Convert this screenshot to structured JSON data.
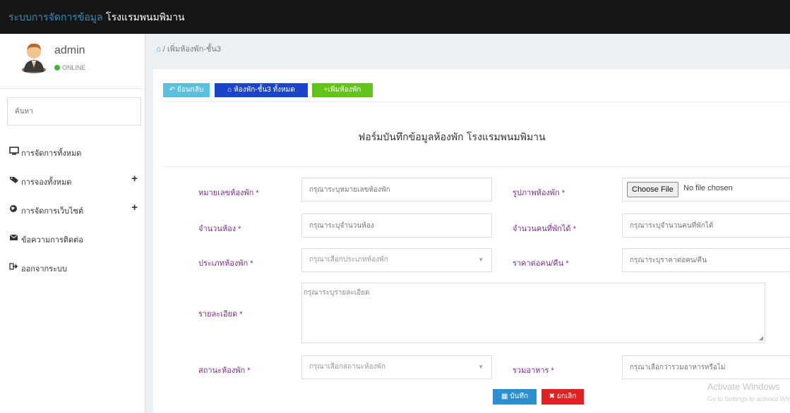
{
  "brand": {
    "part1": "ระบบการจัดการข้อมูล",
    "part2": " โรงแรมพนมพิมาน"
  },
  "user": {
    "name": "admin",
    "status": "ONLINE"
  },
  "sidebar": {
    "search_placeholder": "ค้นหา",
    "items": [
      {
        "icon": "monitor-icon",
        "label": "การจัดการทั้งหมด"
      },
      {
        "icon": "tag-icon",
        "label": "การจองทั้งหมด",
        "expand": "+"
      },
      {
        "icon": "globe-icon",
        "label": "การจัดการเว็บไซต์",
        "expand": "+"
      },
      {
        "icon": "envelope-icon",
        "label": "ข้อความการติดต่อ"
      },
      {
        "icon": "sign-out-icon",
        "label": "ออกจากระบบ"
      }
    ]
  },
  "breadcrumb": {
    "home_icon": "home-icon",
    "separator": "/",
    "current": "เพิ่มห้องพัก-ชั้น3"
  },
  "toolbar": {
    "back_label": "ย้อนกลับ",
    "all_rooms_label": "ห้องพัก-ชั้น3 ทั้งหมด",
    "add_room_label": "เพิ่มห้องพัก"
  },
  "form": {
    "title": "ฟอร์มบันทึกข้อมูลห้องพัก โรงแรมพนมพิมาน",
    "room_number": {
      "label": "หมายเลขห้องพัก *",
      "placeholder": "กรุณาระบุหมายเลขห้องพัก"
    },
    "room_image": {
      "label": "รูปภาพห้องพัก *",
      "button": "Choose File",
      "status": "No file chosen"
    },
    "room_count": {
      "label": "จำนวนห้อง *",
      "placeholder": "กรุณาระบุจำนวนห้อง"
    },
    "guests": {
      "label": "จำนวนคนที่พักได้ *",
      "placeholder": "กรุณาระบุจำนวนคนที่พักได้"
    },
    "room_type": {
      "label": "ประเภทห้องพัก *",
      "placeholder": "กรุณาเลือกประเภทห้องพัก"
    },
    "price": {
      "label": "ราคาต่อคน/คืน *",
      "placeholder": "กรุณาระบุราคาต่อคน/คืน"
    },
    "details": {
      "label": "รายละเอียด *",
      "placeholder": "กรุณาระบุรายละเอียด"
    },
    "room_status": {
      "label": "สถานะห้องพัก *",
      "placeholder": "กรุณาเลือกสถานะห้องพัก"
    },
    "meals": {
      "label": "รวมอาหาร *",
      "placeholder": "กรุณาเลือกว่ารวมอาหารหรือไม่"
    },
    "save_label": "บันทึก",
    "cancel_label": "ยกเลิก"
  },
  "watermark": {
    "line1": "Activate Windows",
    "line2": "Go to Settings to activate Windows."
  }
}
